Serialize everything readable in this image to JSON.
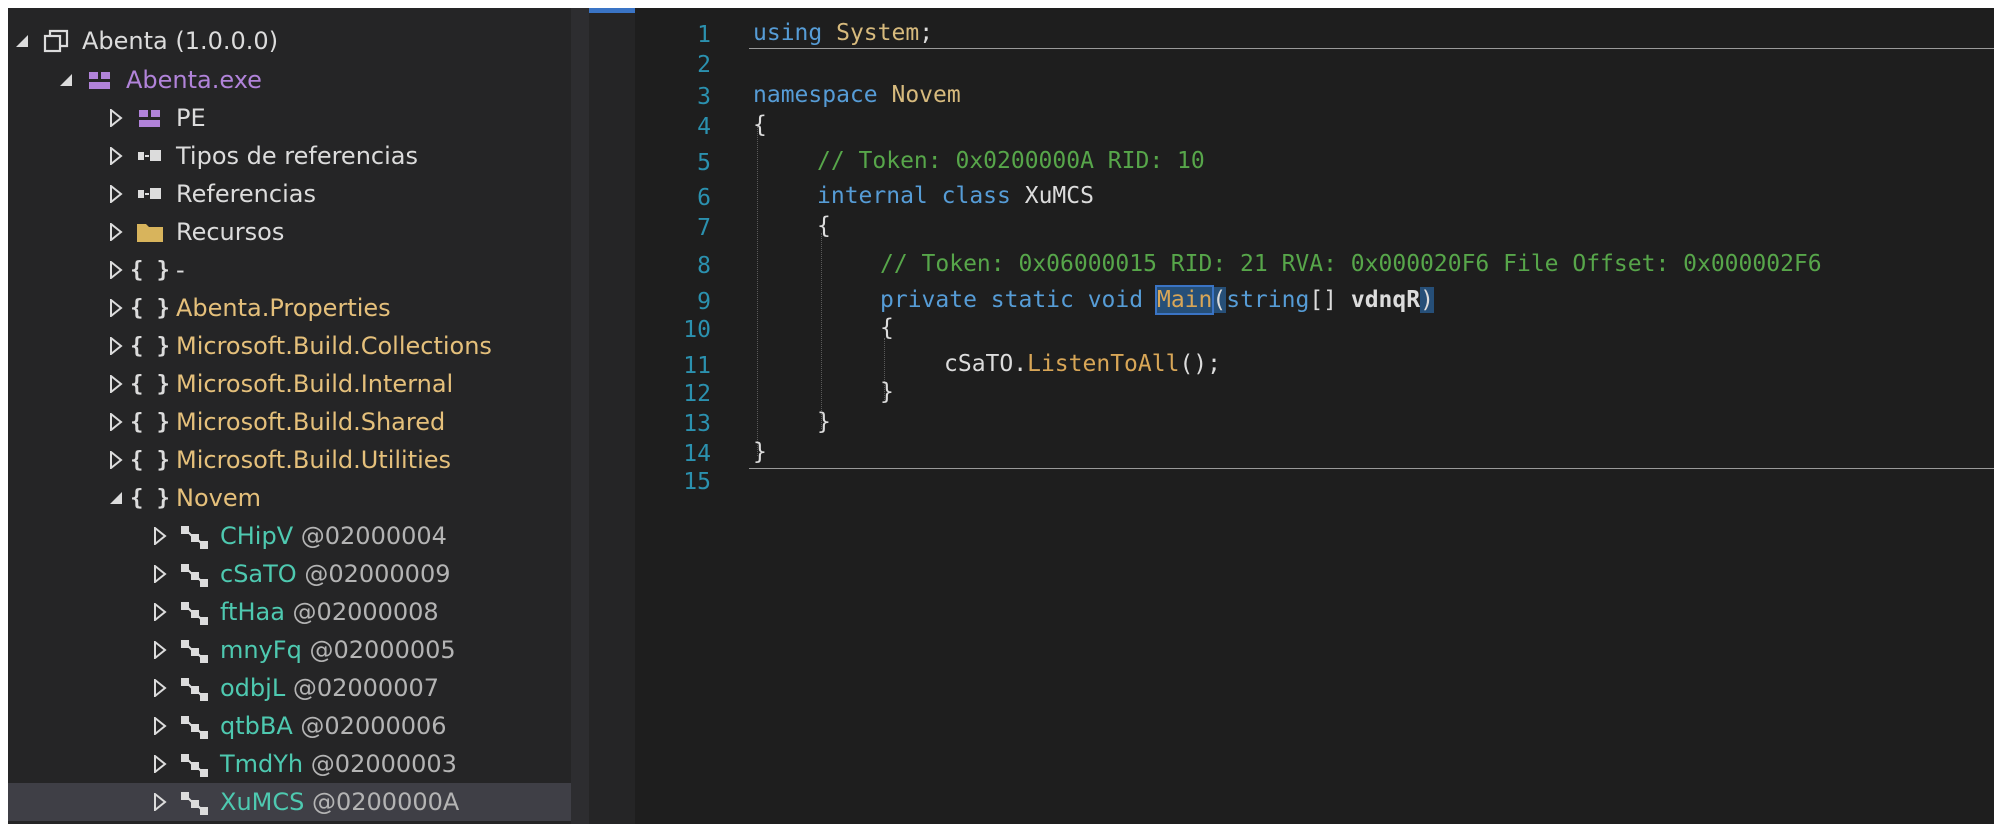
{
  "tree": {
    "root": {
      "label": "Abenta (1.0.0.0)",
      "icon": "assembly-icon"
    },
    "module": {
      "label": "Abenta.exe",
      "icon": "module-icon"
    },
    "items": [
      {
        "label": "PE",
        "icon": "pe-icon"
      },
      {
        "label": "Tipos de referencias",
        "icon": "reference-icon"
      },
      {
        "label": "Referencias",
        "icon": "reference-icon"
      },
      {
        "label": "Recursos",
        "icon": "folder-icon"
      },
      {
        "label": "-",
        "icon": "namespace-icon"
      },
      {
        "label": "Abenta.Properties",
        "icon": "namespace-icon"
      },
      {
        "label": "Microsoft.Build.Collections",
        "icon": "namespace-icon"
      },
      {
        "label": "Microsoft.Build.Internal",
        "icon": "namespace-icon"
      },
      {
        "label": "Microsoft.Build.Shared",
        "icon": "namespace-icon"
      },
      {
        "label": "Microsoft.Build.Utilities",
        "icon": "namespace-icon"
      }
    ],
    "namespace": {
      "label": "Novem",
      "icon": "namespace-icon"
    },
    "classes": [
      {
        "name": "CHipV",
        "token": "@02000004"
      },
      {
        "name": "cSaTO",
        "token": "@02000009"
      },
      {
        "name": "ftHaa",
        "token": "@02000008"
      },
      {
        "name": "mnyFq",
        "token": "@02000005"
      },
      {
        "name": "odbjL",
        "token": "@02000007"
      },
      {
        "name": "qtbBA",
        "token": "@02000006"
      },
      {
        "name": "TmdYh",
        "token": "@02000003"
      },
      {
        "name": "XuMCS",
        "token": "@0200000A"
      }
    ]
  },
  "editor": {
    "line_numbers": [
      "1",
      "2",
      "3",
      "4",
      "5",
      "6",
      "7",
      "8",
      "9",
      "10",
      "11",
      "12",
      "13",
      "14",
      "15"
    ],
    "l1": {
      "kw": "using",
      "ns": "System",
      "end": ";"
    },
    "l3": {
      "kw": "namespace",
      "ns": "Novem"
    },
    "l4": "{",
    "l5": "// Token: 0x0200000A RID: 10",
    "l6": {
      "kw": "internal class",
      "name": "XuMCS"
    },
    "l7": "{",
    "l8": "// Token: 0x06000015 RID: 21 RVA: 0x000020F6 File Offset: 0x000002F6",
    "l9": {
      "kw": "private static void",
      "method": "Main",
      "open": "(",
      "ptype": "string",
      "arr": "[] ",
      "param": "vdnqR",
      "close": ")"
    },
    "l10": "{",
    "l11": {
      "obj": "cSaTO",
      "dot": ".",
      "call": "ListenToAll",
      "end": "();"
    },
    "l12": "}",
    "l13": "}",
    "l14": "}"
  },
  "colors": {
    "accent": "#3a74c5",
    "namespace": "#e5c07b",
    "type": "#4ec9b0",
    "comment": "#57a64a",
    "keyword": "#569cd6"
  }
}
